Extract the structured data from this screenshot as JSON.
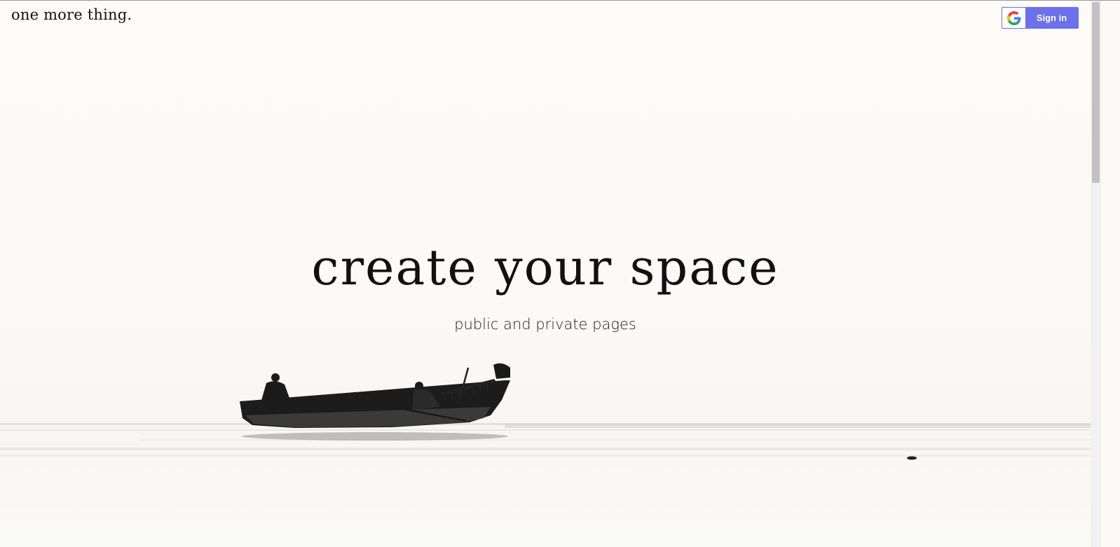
{
  "header": {
    "brand": "one more thing.",
    "signin_label": "Sign in",
    "signin_icon": "google-g-icon"
  },
  "hero": {
    "title": "create your space",
    "subtitle": "public and private pages"
  },
  "colors": {
    "signin_bg": "#6c70ec",
    "background": "#fbfaf7",
    "text": "#111111"
  }
}
